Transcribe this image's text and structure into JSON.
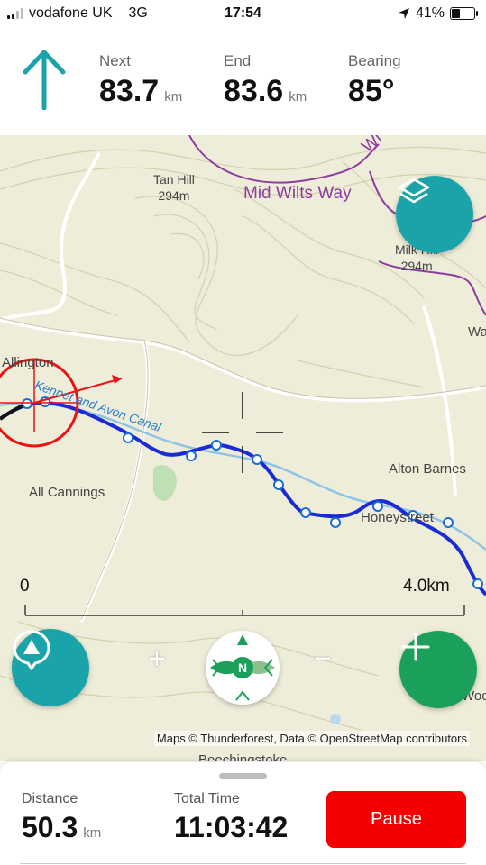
{
  "status_bar": {
    "carrier": "vodafone UK",
    "network": "3G",
    "time": "17:54",
    "battery": "41%",
    "battery_level": 0.41
  },
  "nav": {
    "next_label": "Next",
    "next_value": "83.7",
    "next_unit": "km",
    "end_label": "End",
    "end_value": "83.6",
    "end_unit": "km",
    "bearing_label": "Bearing",
    "bearing_value": "85°"
  },
  "map": {
    "labels": {
      "tan_hill": "Tan Hill",
      "tan_hill_height": "294m",
      "mid_wilts_way": "Mid Wilts Way",
      "milk_hill": "Milk Hill",
      "milk_hill_height": "294m",
      "allington": "Allington",
      "canal": "Kennet and Avon Canal",
      "all_cannings": "All Cannings",
      "alton_barnes": "Alton Barnes",
      "honeystreet": "Honeystreet",
      "wa": "Wa",
      "woo": "Woo",
      "beechingstoke": "Beechingstoke",
      "wi": "Wi"
    },
    "scale_start": "0",
    "scale_end": "4.0km",
    "zoom_in": "+",
    "zoom_out": "−",
    "compass_label": "N",
    "attribution": "Maps © Thunderforest, Data © OpenStreetMap contributors"
  },
  "colors": {
    "teal": "#1aa4a9",
    "green": "#1aa05a",
    "route": "#1a2ad4",
    "pause": "#f50000",
    "footpath": "#8e3c9e"
  },
  "bottom": {
    "distance_label": "Distance",
    "distance_value": "50.3",
    "distance_unit": "km",
    "time_label": "Total Time",
    "time_value": "11:03:42",
    "pause_label": "Pause"
  }
}
